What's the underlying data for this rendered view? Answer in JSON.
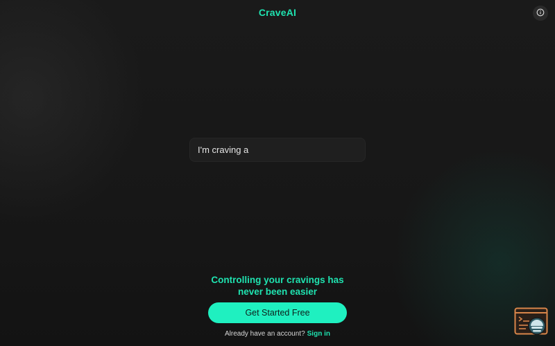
{
  "header": {
    "brand": "CraveAI"
  },
  "prompt": {
    "text": "I'm craving a"
  },
  "hero": {
    "tagline_line1": "Controlling your cravings has",
    "tagline_line2": "never been easier"
  },
  "cta": {
    "label": "Get Started Free"
  },
  "signin": {
    "prefix": "Already have an account?",
    "link": "Sign in"
  },
  "icons": {
    "info": "info-icon",
    "widget": "chat-widget-icon"
  },
  "colors": {
    "accent": "#1fe3b0",
    "button": "#1ff0c0",
    "background": "#161616",
    "widget": "#d9864a"
  }
}
